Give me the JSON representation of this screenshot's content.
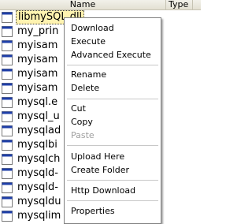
{
  "header": {
    "name": "Name",
    "type": "Type"
  },
  "files": [
    "libmySQL.dll",
    "my_prin",
    "myisam",
    "myisam",
    "myisam",
    "myisam",
    "mysql.e",
    "mysql_u",
    "mysqlad",
    "mysqlbi",
    "mysqlch",
    "mysqld-",
    "mysqld-",
    "mysqldu",
    "mysqlim"
  ],
  "context_menu": {
    "download": "Download",
    "execute": "Execute",
    "advanced_execute": "Advanced Execute",
    "rename": "Rename",
    "delete": "Delete",
    "cut": "Cut",
    "copy": "Copy",
    "paste": "Paste",
    "upload_here": "Upload Here",
    "create_folder": "Create Folder",
    "http_download": "Http Download",
    "properties": "Properties"
  },
  "colors": {
    "menu_border": "#808080",
    "disabled_text": "#a0a0a0",
    "selection_fill": "#fff3b0",
    "icon_bar": "#1f3fa8"
  },
  "icons": {
    "file": "file-icon"
  }
}
